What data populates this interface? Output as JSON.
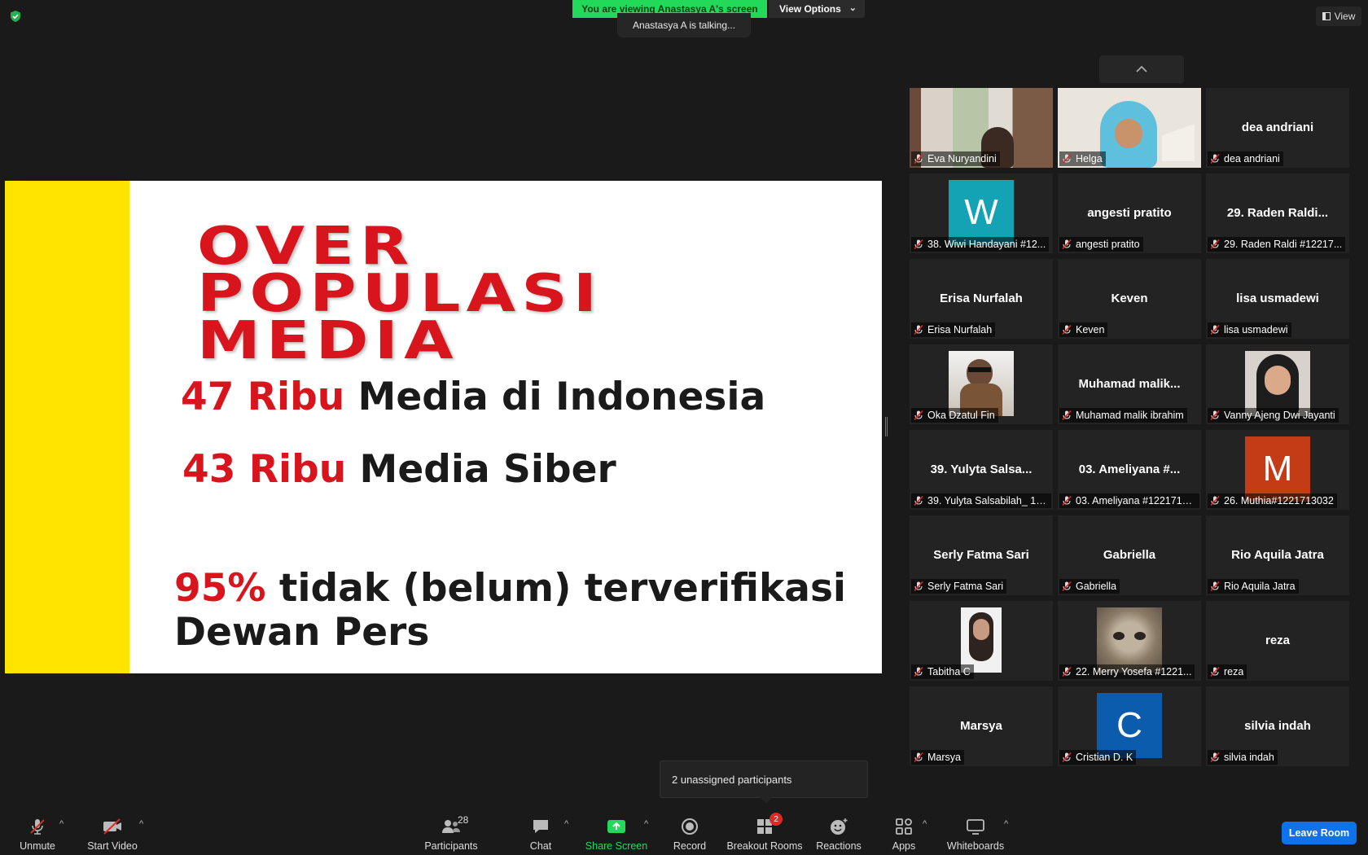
{
  "banner": {
    "viewing": "You are viewing Anastasya A's screen",
    "view_options": "View Options",
    "talking": "Anastasya A is talking...",
    "view_button": "View"
  },
  "slide": {
    "title_lines": [
      "OVER",
      "POPULASI",
      "MEDIA"
    ],
    "line1_num": "47 Ribu",
    "line1_text": " Media di Indonesia",
    "line2_num": "43 Ribu",
    "line2_text": " Media Siber",
    "line3_num": "95%",
    "line3_text": " tidak (belum) terverifikasi",
    "line3_text2": "Dewan Pers",
    "colors": {
      "accent_red": "#d8141c",
      "sidebar_yellow": "#ffe400"
    }
  },
  "gallery": {
    "tiles": [
      {
        "label": "Eva Nuryandini",
        "kind": "photo-bookshelf"
      },
      {
        "label": "Helga",
        "kind": "photo-hijab"
      },
      {
        "label": "dea andriani",
        "big": "dea andriani"
      },
      {
        "label": "38. Wiwi Handayani #12...",
        "avatar": "W",
        "color": "#13a3b4"
      },
      {
        "label": "angesti pratito",
        "big": "angesti pratito"
      },
      {
        "label": "29. Raden Raldi #12217...",
        "big": "29. Raden Raldi..."
      },
      {
        "label": "Erisa Nurfalah",
        "big": "Erisa Nurfalah"
      },
      {
        "label": "Keven",
        "big": "Keven"
      },
      {
        "label": "lisa usmadewi",
        "big": "lisa usmadewi"
      },
      {
        "label": "Oka Dzatul Fin",
        "kind": "photo-man"
      },
      {
        "label": "Muhamad malik ibrahim",
        "big": "Muhamad  malik..."
      },
      {
        "label": "Vanny Ajeng Dwi Jayanti",
        "kind": "photo-hijab2"
      },
      {
        "label": "39. Yulyta Salsabilah_ 12...",
        "big": "39. Yulyta Salsa..."
      },
      {
        "label": "03. Ameliyana #1221713...",
        "big": "03. Ameliyana #..."
      },
      {
        "label": "26. Muthia#1221713032",
        "avatar": "M",
        "color": "#c43c16"
      },
      {
        "label": "Serly Fatma Sari",
        "big": "Serly Fatma Sari"
      },
      {
        "label": "Gabriella",
        "big": "Gabriella"
      },
      {
        "label": "Rio Aquila Jatra",
        "big": "Rio Aquila Jatra"
      },
      {
        "label": "Tabitha C",
        "kind": "photo-woman"
      },
      {
        "label": "22. Merry Yosefa #1221...",
        "kind": "photo-cat"
      },
      {
        "label": "reza",
        "big": "reza"
      },
      {
        "label": "Marsya",
        "big": "Marsya"
      },
      {
        "label": "Cristian D. K",
        "avatar": "C",
        "color": "#0b5cad"
      },
      {
        "label": "silvia indah",
        "big": "silvia indah"
      }
    ]
  },
  "tooltip": {
    "unassigned": "2 unassigned participants"
  },
  "toolbar": {
    "unmute": "Unmute",
    "start_video": "Start Video",
    "participants": "Participants",
    "participants_count": "28",
    "chat": "Chat",
    "share_screen": "Share Screen",
    "record": "Record",
    "breakout_rooms": "Breakout Rooms",
    "breakout_badge": "2",
    "reactions": "Reactions",
    "apps": "Apps",
    "whiteboards": "Whiteboards",
    "leave": "Leave Room"
  }
}
